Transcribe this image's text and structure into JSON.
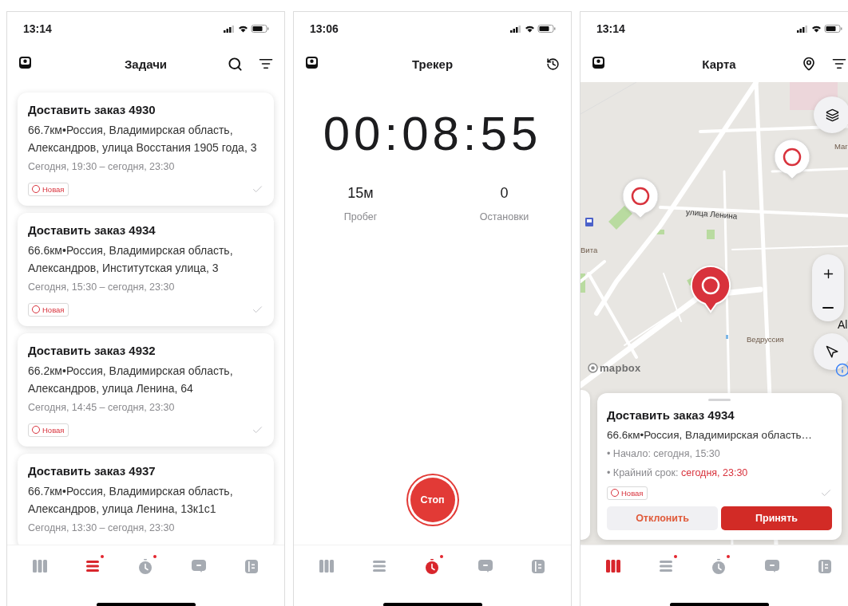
{
  "screens": [
    {
      "kind": "tasks",
      "status_time": "13:14",
      "title": "Задачи",
      "tasks": [
        {
          "title": "Доставить заказ 4930",
          "address": "66.7км•Россия, Владимирская область, Александров, улица Восстания 1905 года, 3",
          "time": "Сегодня, 19:30 – сегодня, 23:30",
          "status": "Новая"
        },
        {
          "title": "Доставить заказ 4934",
          "address": "66.6км•Россия, Владимирская область, Александров, Институтская улица, 3",
          "time": "Сегодня, 15:30 – сегодня, 23:30",
          "status": "Новая"
        },
        {
          "title": "Доставить заказ 4932",
          "address": "66.2км•Россия, Владимирская область, Александров, улица Ленина, 64",
          "time": "Сегодня, 14:45 – сегодня, 23:30",
          "status": "Новая"
        },
        {
          "title": "Доставить заказ 4937",
          "address": "66.7км•Россия, Владимирская область, Александров, улица Ленина, 13к1с1",
          "time": "Сегодня, 13:30 – сегодня, 23:30"
        }
      ],
      "nav": [
        {
          "kind": "map",
          "selected": false,
          "dot": false
        },
        {
          "kind": "tasks",
          "selected": true,
          "dot": true
        },
        {
          "kind": "timer",
          "selected": false,
          "dot": true
        },
        {
          "kind": "chat",
          "selected": false,
          "dot": false
        },
        {
          "kind": "profile",
          "selected": false,
          "dot": false
        }
      ]
    },
    {
      "kind": "tracker",
      "status_time": "13:06",
      "title": "Трекер",
      "timer": "00:08:55",
      "stats": [
        {
          "value": "15м",
          "label": "Пробег"
        },
        {
          "value": "0",
          "label": "Остановки"
        }
      ],
      "stop_button": "Стоп",
      "nav": [
        {
          "kind": "map",
          "selected": false,
          "dot": false
        },
        {
          "kind": "tasks",
          "selected": false,
          "dot": false
        },
        {
          "kind": "timer",
          "selected": true,
          "dot": true
        },
        {
          "kind": "chat",
          "selected": false,
          "dot": false
        },
        {
          "kind": "profile",
          "selected": false,
          "dot": false
        }
      ]
    },
    {
      "kind": "map",
      "status_time": "13:14",
      "title": "Карта",
      "map_labels": [
        {
          "kind": "street",
          "text": "улица Ленина"
        },
        {
          "kind": "poi",
          "text": "Вита"
        },
        {
          "kind": "poi",
          "text": "Ведруссия"
        },
        {
          "kind": "poi",
          "text": "Маг"
        },
        {
          "kind": "place",
          "text": "Al"
        }
      ],
      "attribution": "mapbox",
      "sheet": {
        "title": "Доставить заказ 4934",
        "address": "66.6км•Россия, Владимирская область…",
        "start": "• Начало: сегодня, 15:30",
        "deadline_label": "• Крайний срок:",
        "deadline_value": "сегодня, 23:30",
        "status": "Новая",
        "buttons": [
          {
            "kind": "secondary",
            "label": "Отклонить"
          },
          {
            "kind": "primary",
            "label": "Принять"
          }
        ]
      },
      "nav": [
        {
          "kind": "map",
          "selected": true,
          "dot": false
        },
        {
          "kind": "tasks",
          "selected": false,
          "dot": true
        },
        {
          "kind": "timer",
          "selected": false,
          "dot": true
        },
        {
          "kind": "chat",
          "selected": false,
          "dot": false
        },
        {
          "kind": "profile",
          "selected": false,
          "dot": false
        }
      ]
    }
  ]
}
